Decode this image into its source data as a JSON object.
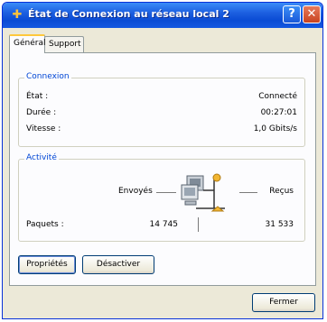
{
  "window": {
    "title": "État de Connexion au réseau local 2",
    "help_label": "?",
    "close_label": "✕"
  },
  "tabs": [
    {
      "label": "Général",
      "active": true
    },
    {
      "label": "Support",
      "active": false
    }
  ],
  "connection": {
    "group_title": "Connexion",
    "rows": [
      {
        "label": "État :",
        "value": "Connecté"
      },
      {
        "label": "Durée :",
        "value": "00:27:01"
      },
      {
        "label": "Vitesse :",
        "value": "1,0 Gbits/s"
      }
    ]
  },
  "activity": {
    "group_title": "Activité",
    "sent_label": "Envoyés",
    "received_label": "Reçus",
    "packets_label": "Paquets :",
    "packets_sent": "14 745",
    "packets_received": "31 533"
  },
  "buttons": {
    "properties": "Propriétés",
    "disable": "Désactiver",
    "close": "Fermer"
  },
  "icons": {
    "title_icon": "network-connection-icon",
    "activity_icon": "network-computers-icon"
  }
}
